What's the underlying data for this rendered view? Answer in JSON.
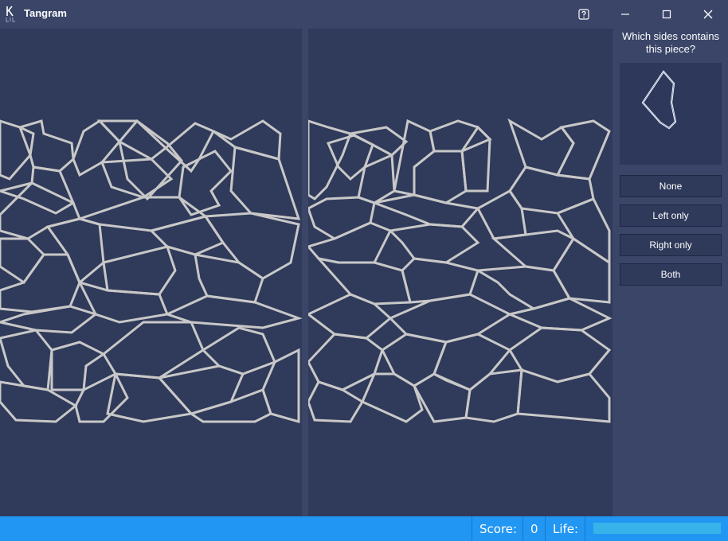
{
  "window": {
    "title": "Tangram",
    "icon": "k-logo-icon",
    "controls": [
      "help-icon",
      "minimize-icon",
      "maximize-icon",
      "close-icon"
    ]
  },
  "sidebar": {
    "question": "Which sides contains this piece?",
    "choices": [
      {
        "label": "None"
      },
      {
        "label": "Left only"
      },
      {
        "label": "Right only"
      },
      {
        "label": "Both"
      }
    ]
  },
  "status": {
    "score_label": "Score:",
    "score_value": "0",
    "life_label": "Life:",
    "life_fraction": 1.0
  },
  "colors": {
    "background": "#303a5a",
    "panel": "#3a4568",
    "piece_stroke": "#c8c8c8",
    "statusbar": "#2196f3",
    "life_fill": "#37b3ea"
  }
}
